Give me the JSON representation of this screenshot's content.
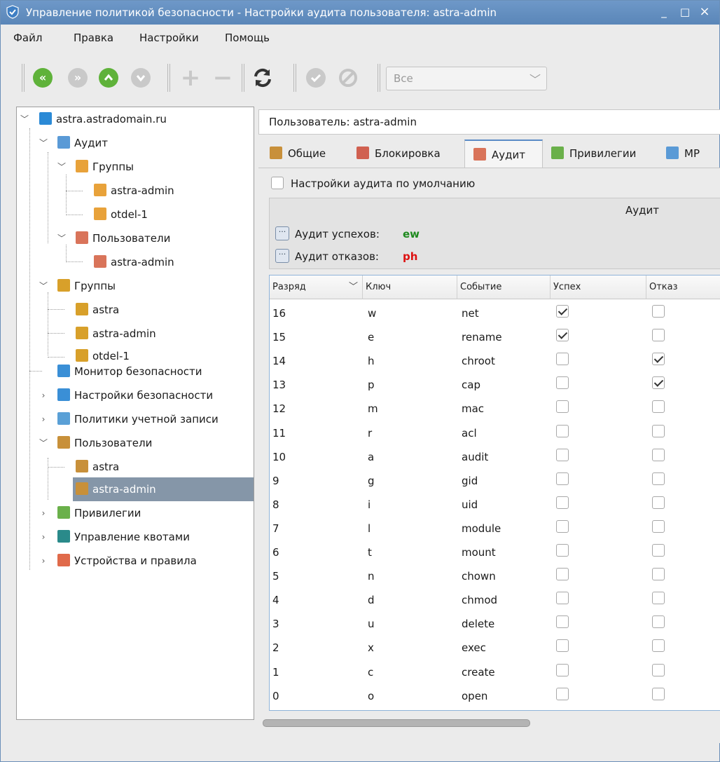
{
  "window": {
    "title": "Управление политикой безопасности - Настройки аудита пользователя: astra-admin",
    "minimize": "_",
    "maximize": "□",
    "close": "×"
  },
  "menu": [
    "Файл",
    "Правка",
    "Настройки",
    "Помощь"
  ],
  "toolbar": {
    "filter_value": "Все",
    "buttons": [
      "first-icon",
      "next-icon",
      "up-icon",
      "down-icon",
      "add-icon",
      "remove-icon",
      "refresh-icon",
      "apply-icon",
      "cancel-icon"
    ]
  },
  "tree": {
    "root": "astra.astradomain.ru",
    "audit": "Аудит",
    "audit_groups": "Группы",
    "audit_group_1": "astra-admin",
    "audit_group_2": "otdel-1",
    "audit_users": "Пользователи",
    "audit_user_1": "astra-admin",
    "groups": "Группы",
    "group_1": "astra",
    "group_2": "astra-admin",
    "group_3": "otdel-1",
    "monitor": "Монитор безопасности",
    "security_settings": "Настройки безопасности",
    "account_policies": "Политики учетной записи",
    "users": "Пользователи",
    "user_1": "astra",
    "user_2": "astra-admin",
    "privileges": "Привилегии",
    "quotas": "Управление квотами",
    "devices": "Устройства и правила"
  },
  "user_label": "Пользователь: astra-admin",
  "tabs": [
    "Общие",
    "Блокировка",
    "Аудит",
    "Привилегии",
    "МР"
  ],
  "default_audit_label": "Настройки аудита по умолчанию",
  "audit": {
    "header": "Аудит",
    "success_label": "Аудит успехов:",
    "success_value": "ew",
    "success_color": "#1e8a1e",
    "fail_label": "Аудит отказов:",
    "fail_value": "ph",
    "fail_color": "#dd1111"
  },
  "table": {
    "columns": [
      "Разряд",
      "Ключ",
      "Событие",
      "Успех",
      "Отказ"
    ],
    "rows": [
      {
        "bit": "16",
        "key": "w",
        "event": "net",
        "success": true,
        "fail": false
      },
      {
        "bit": "15",
        "key": "e",
        "event": "rename",
        "success": true,
        "fail": false
      },
      {
        "bit": "14",
        "key": "h",
        "event": "chroot",
        "success": false,
        "fail": true
      },
      {
        "bit": "13",
        "key": "p",
        "event": "cap",
        "success": false,
        "fail": true
      },
      {
        "bit": "12",
        "key": "m",
        "event": "mac",
        "success": false,
        "fail": false
      },
      {
        "bit": "11",
        "key": "r",
        "event": "acl",
        "success": false,
        "fail": false
      },
      {
        "bit": "10",
        "key": "a",
        "event": "audit",
        "success": false,
        "fail": false
      },
      {
        "bit": "9",
        "key": "g",
        "event": "gid",
        "success": false,
        "fail": false
      },
      {
        "bit": "8",
        "key": "i",
        "event": "uid",
        "success": false,
        "fail": false
      },
      {
        "bit": "7",
        "key": "l",
        "event": "module",
        "success": false,
        "fail": false
      },
      {
        "bit": "6",
        "key": "t",
        "event": "mount",
        "success": false,
        "fail": false
      },
      {
        "bit": "5",
        "key": "n",
        "event": "chown",
        "success": false,
        "fail": false
      },
      {
        "bit": "4",
        "key": "d",
        "event": "chmod",
        "success": false,
        "fail": false
      },
      {
        "bit": "3",
        "key": "u",
        "event": "delete",
        "success": false,
        "fail": false
      },
      {
        "bit": "2",
        "key": "x",
        "event": "exec",
        "success": false,
        "fail": false
      },
      {
        "bit": "1",
        "key": "c",
        "event": "create",
        "success": false,
        "fail": false
      },
      {
        "bit": "0",
        "key": "o",
        "event": "open",
        "success": false,
        "fail": false
      }
    ]
  }
}
